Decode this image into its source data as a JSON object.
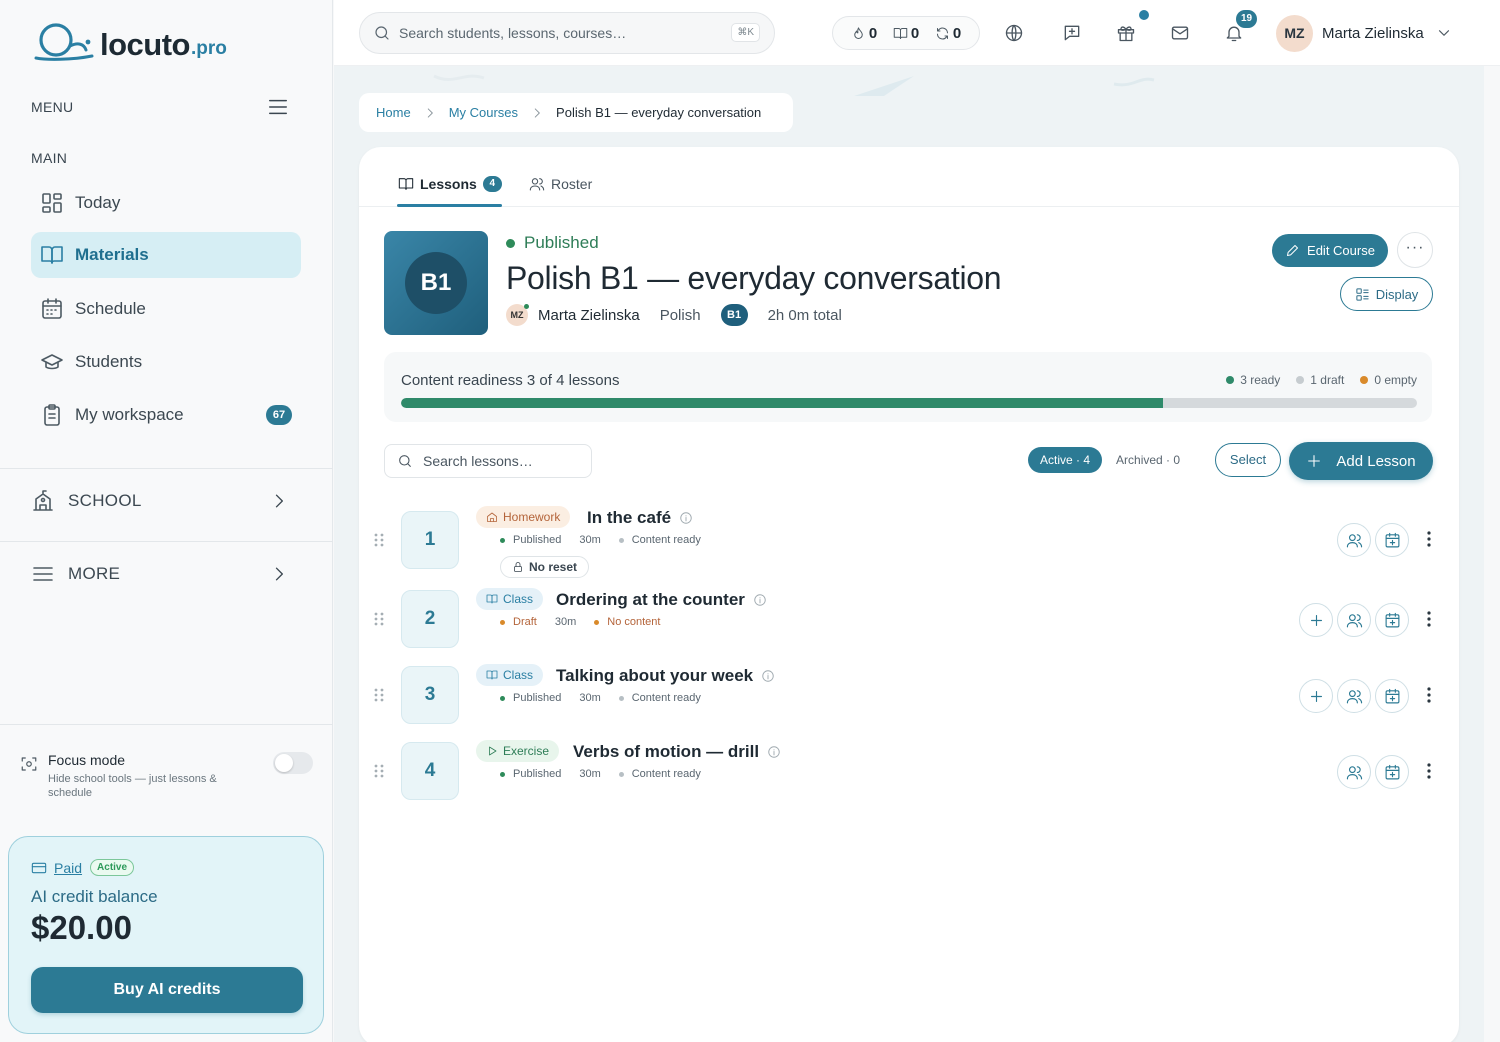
{
  "brand": {
    "name": "locuto",
    "suffix": ".pro",
    "accent": "#2c7a94"
  },
  "sidebar": {
    "menu_label": "MENU",
    "section_label": "MAIN",
    "items": [
      {
        "label": "Today",
        "icon": "dashboard-icon"
      },
      {
        "label": "Materials",
        "icon": "book-icon",
        "active": true
      },
      {
        "label": "Schedule",
        "icon": "calendar-icon"
      },
      {
        "label": "Students",
        "icon": "graduation-cap-icon"
      },
      {
        "label": "My workspace",
        "icon": "clipboard-icon",
        "badge": "67"
      }
    ],
    "school_label": "SCHOOL",
    "more_label": "MORE",
    "focus": {
      "title": "Focus mode",
      "desc": "Hide school tools — just lessons & schedule",
      "enabled": false
    },
    "credits": {
      "plan": "Paid",
      "status": "Active",
      "title": "AI credit balance",
      "amount": "$20.00",
      "button": "Buy AI credits"
    }
  },
  "topbar": {
    "search_placeholder": "Search students, lessons, courses…",
    "shortcut": "⌘K",
    "stats": [
      "0",
      "0",
      "0"
    ],
    "notifications": "19",
    "user": {
      "initials": "MZ",
      "name": "Marta Zielinska"
    }
  },
  "breadcrumb": {
    "home": "Home",
    "courses": "My Courses",
    "current": "Polish B1 — everyday conversation"
  },
  "tabs": {
    "lessons": "Lessons",
    "lessons_count": "4",
    "roster": "Roster"
  },
  "course": {
    "level": "B1",
    "status": "Published",
    "title": "Polish B1 — everyday conversation",
    "teacher_initials": "MZ",
    "teacher": "Marta Zielinska",
    "language": "Polish",
    "level_badge": "B1",
    "total": "2h 0m total",
    "edit_label": "Edit Course",
    "more_label": "···",
    "display_label": "Display"
  },
  "readiness": {
    "label": "Content readiness 3 of 4 lessons",
    "ready": "3 ready",
    "draft": "1 draft",
    "empty": "0 empty",
    "fraction": 0.75
  },
  "toolbar": {
    "search_placeholder": "Search lessons…",
    "active": "Active · 4",
    "archived": "Archived · 0",
    "select": "Select",
    "add": "Add Lesson"
  },
  "lessons": [
    {
      "num": "1",
      "type": "Homework",
      "title": "In the café",
      "status": "Published",
      "duration": "30m",
      "content": "Content ready",
      "extra": "No reset"
    },
    {
      "num": "2",
      "type": "Class",
      "title": "Ordering at the counter",
      "status": "Draft",
      "duration": "30m",
      "content": "No content"
    },
    {
      "num": "3",
      "type": "Class",
      "title": "Talking about your week",
      "status": "Published",
      "duration": "30m",
      "content": "Content ready"
    },
    {
      "num": "4",
      "type": "Exercise",
      "title": "Verbs of motion — drill",
      "status": "Published",
      "duration": "30m",
      "content": "Content ready"
    }
  ]
}
